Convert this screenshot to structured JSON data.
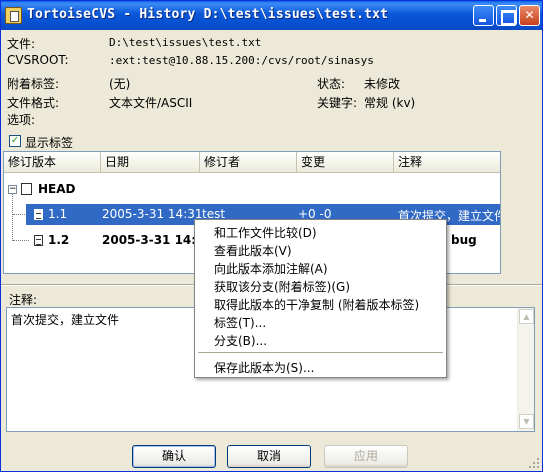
{
  "window": {
    "title": "TortoiseCVS - History D:\\test\\issues\\test.txt"
  },
  "titlebar_buttons": [
    "minimize-icon",
    "maximize-icon",
    "close-icon"
  ],
  "info": {
    "file_label": "文件:",
    "file_value": "D:\\test\\issues\\test.txt",
    "cvsroot_label": "CVSROOT:",
    "cvsroot_value": ":ext:test@10.88.15.200:/cvs/root/sinasys",
    "tags_label": "附着标签:",
    "tags_value": "(无)",
    "status_label": "状态:",
    "status_value": "未修改",
    "format_label": "文件格式:",
    "format_value": "文本文件/ASCII",
    "keyword_label": "关键字:",
    "keyword_value": "常规 (kv)",
    "options_label": "选项:"
  },
  "show_tags": {
    "label": "显示标签",
    "checked": true
  },
  "revision_list": {
    "columns": [
      "修订版本",
      "日期",
      "修订者",
      "变更",
      "注释"
    ],
    "root": "HEAD",
    "rows": [
      {
        "revision": "1.1",
        "date": "2005-3-31 14:31",
        "author": "test",
        "changes": "+0 -0",
        "comment": "首次提交，建立文件",
        "selected": true
      },
      {
        "revision": "1.2",
        "date": "2005-3-31 14:32",
        "author": "",
        "changes": "",
        "comment": "bug",
        "selected": false
      }
    ]
  },
  "comment": {
    "label": "注释:",
    "text": "首次提交，建立文件"
  },
  "context_menu": {
    "items": [
      "和工作文件比较(D)",
      "查看此版本(V)",
      "向此版本添加注解(A)",
      "获取该分支(附着标签)(G)",
      "取得此版本的干净复制 (附着版本标签)",
      "标签(T)...",
      "分支(B)...",
      "保存此版本为(S)..."
    ]
  },
  "buttons": {
    "ok": "确认",
    "cancel": "取消",
    "apply": "应用"
  },
  "colors": {
    "selection": "#316ac5",
    "titlebar": "#0a57d8",
    "dialog_bg": "#ece9d8"
  }
}
